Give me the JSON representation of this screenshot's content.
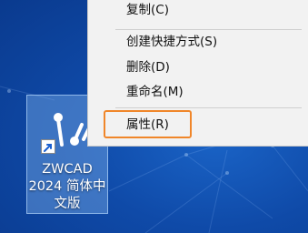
{
  "desktop": {
    "icon_label_lines": [
      "ZWCAD",
      "2024 简体中",
      "文版"
    ]
  },
  "context_menu": {
    "items": [
      {
        "label": "复制(C)"
      },
      {
        "label": "创建快捷方式(S)"
      },
      {
        "label": "删除(D)"
      },
      {
        "label": "重命名(M)"
      },
      {
        "label": "属性(R)"
      }
    ]
  },
  "colors": {
    "desktop_bg": "#0f4aa8",
    "menu_bg": "#f2f2f2",
    "highlight": "#f0862a"
  }
}
